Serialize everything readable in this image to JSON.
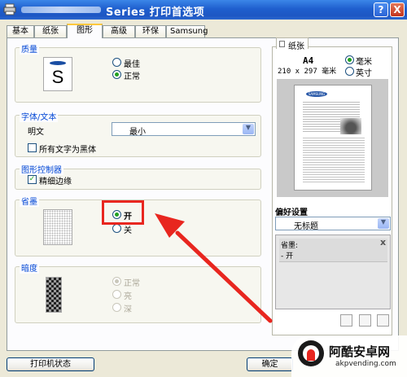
{
  "window": {
    "title": "Series 打印首选项",
    "help_label": "?",
    "close_label": "X"
  },
  "tabs": [
    {
      "label": "基本"
    },
    {
      "label": "纸张"
    },
    {
      "label": "图形"
    },
    {
      "label": "高级"
    },
    {
      "label": "环保"
    },
    {
      "label": "Samsung"
    }
  ],
  "quality": {
    "group_label": "质量",
    "icon_letter": "S",
    "options": [
      {
        "label": "最佳",
        "selected": false
      },
      {
        "label": "正常",
        "selected": true
      }
    ]
  },
  "font_text": {
    "group_label": "字体/文本",
    "font_label": "明文",
    "font_value": "最小",
    "all_black_label": "所有文字为黑体",
    "all_black_checked": false
  },
  "graphic_controller": {
    "group_label": "图形控制器",
    "fine_edge_label": "精细边缘",
    "fine_edge_checked": true
  },
  "toner_save": {
    "group_label": "省墨",
    "options": [
      {
        "label": "开",
        "selected": true
      },
      {
        "label": "关",
        "selected": false
      }
    ]
  },
  "darkness": {
    "group_label": "暗度",
    "options": [
      {
        "label": "正常",
        "selected": true,
        "disabled": true
      },
      {
        "label": "亮",
        "selected": false,
        "disabled": true
      },
      {
        "label": "深",
        "selected": false,
        "disabled": true
      }
    ]
  },
  "preview": {
    "tab_label": "纸张",
    "paper_size": "A4",
    "paper_dims": "210 x 297 毫米",
    "units": [
      {
        "label": "毫米",
        "selected": true
      },
      {
        "label": "英寸",
        "selected": false
      }
    ],
    "doc_logo_text": "SAMSUNG"
  },
  "favorites": {
    "label": "偏好设置",
    "selected": "无标题",
    "summary_title": "省墨:",
    "summary_line": "- 开",
    "close_label": "x"
  },
  "footer": {
    "printer_status_label": "打印机状态",
    "ok_label": "确定"
  },
  "watermark": {
    "site_name": "阿酷安卓网",
    "site_url": "akpvending.com"
  },
  "colors": {
    "accent_red": "#e8261f",
    "group_title_blue": "#0046d5",
    "titlebar_blue": "#1f5fce"
  }
}
